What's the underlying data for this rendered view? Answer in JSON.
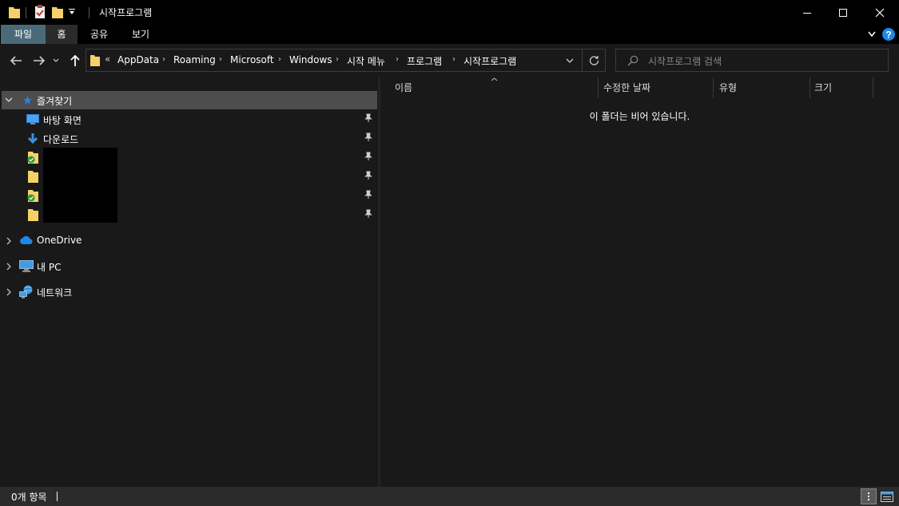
{
  "window": {
    "title": "시작프로그램"
  },
  "ribbon": {
    "tabs": [
      {
        "label": "파일"
      },
      {
        "label": "홈"
      },
      {
        "label": "공유"
      },
      {
        "label": "보기"
      }
    ]
  },
  "address": {
    "overflow": "«",
    "crumbs": [
      "AppData",
      "Roaming",
      "Microsoft",
      "Windows",
      "시작 메뉴",
      "프로그램",
      "시작프로그램"
    ]
  },
  "search": {
    "placeholder": "시작프로그램 검색"
  },
  "nav": {
    "quick_access": "즐겨찾기",
    "pinned": [
      {
        "label": "바탕 화면",
        "icon": "desktop-icon"
      },
      {
        "label": "다운로드",
        "icon": "download-icon"
      }
    ],
    "onedrive": "OneDrive",
    "this_pc": "내 PC",
    "network": "네트워크"
  },
  "columns": {
    "name": "이름",
    "date": "수정한 날짜",
    "type": "유형",
    "size": "크기"
  },
  "content": {
    "empty_message": "이 폴더는 비어 있습니다."
  },
  "status": {
    "item_count": "0개 항목"
  },
  "colors": {
    "background": "#191919",
    "file_tab": "#4a6a7a",
    "selected_row": "#4d4d4d",
    "folder": "#f5d168",
    "accent_blue": "#1e88e5"
  }
}
